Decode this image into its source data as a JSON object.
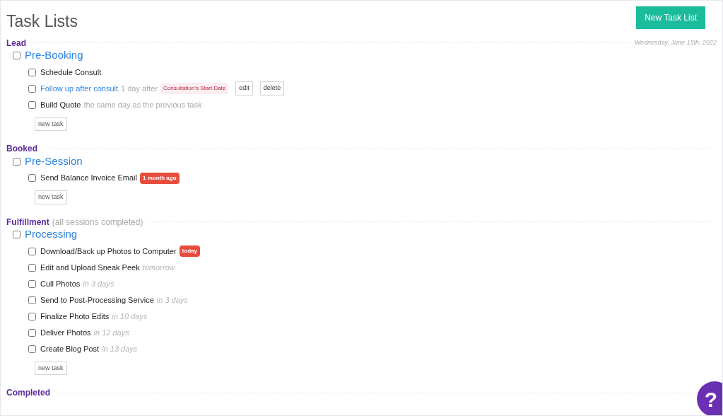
{
  "page": {
    "title": "Task Lists",
    "new_list_button": "New Task List"
  },
  "stages": [
    {
      "name": "Lead",
      "date": "Wednesday, June 15th, 2022",
      "lists": [
        {
          "title": "Pre-Booking",
          "checked": false,
          "new_task": "new task",
          "tasks": [
            {
              "title": "Schedule Consult",
              "checked": false,
              "link": false
            },
            {
              "title": "Follow up after consult",
              "checked": false,
              "link": true,
              "note": {
                "text": "1 day after",
                "kind": "offset"
              },
              "badge": {
                "text": "Consultation's Start Date",
                "kind": "pink"
              },
              "actions": [
                "edit",
                "delete"
              ]
            },
            {
              "title": "Build Quote",
              "checked": false,
              "link": false,
              "note": {
                "text": "the same day as the previous task",
                "kind": "offset"
              }
            }
          ]
        }
      ]
    },
    {
      "name": "Booked",
      "lists": [
        {
          "title": "Pre-Session",
          "checked": false,
          "new_task": "new task",
          "tasks": [
            {
              "title": "Send Balance Invoice Email",
              "checked": false,
              "link": false,
              "badge": {
                "text": "1 month ago",
                "kind": "red"
              }
            }
          ]
        }
      ]
    },
    {
      "name": "Fulfillment",
      "note": "(all sessions completed)",
      "lists": [
        {
          "title": "Processing",
          "checked": false,
          "new_task": "new task",
          "tasks": [
            {
              "title": "Download/Back up Photos to Computer",
              "checked": false,
              "link": false,
              "badge": {
                "text": "today",
                "kind": "red"
              }
            },
            {
              "title": "Edit and Upload Sneak Peek",
              "checked": false,
              "link": false,
              "note": {
                "text": "tomorrow",
                "kind": "relative"
              }
            },
            {
              "title": "Cull Photos",
              "checked": false,
              "link": false,
              "note": {
                "text": "in 3 days",
                "kind": "relative"
              }
            },
            {
              "title": "Send to Post-Processing Service",
              "checked": false,
              "link": false,
              "note": {
                "text": "in 3 days",
                "kind": "relative"
              }
            },
            {
              "title": "Finalize Photo Edits",
              "checked": false,
              "link": false,
              "note": {
                "text": "in 10 days",
                "kind": "relative"
              }
            },
            {
              "title": "Deliver Photos",
              "checked": false,
              "link": false,
              "note": {
                "text": "in 12 days",
                "kind": "relative"
              }
            },
            {
              "title": "Create Blog Post",
              "checked": false,
              "link": false,
              "note": {
                "text": "in 13 days",
                "kind": "relative"
              }
            }
          ]
        }
      ]
    },
    {
      "name": "Completed"
    }
  ],
  "help_button": "?"
}
